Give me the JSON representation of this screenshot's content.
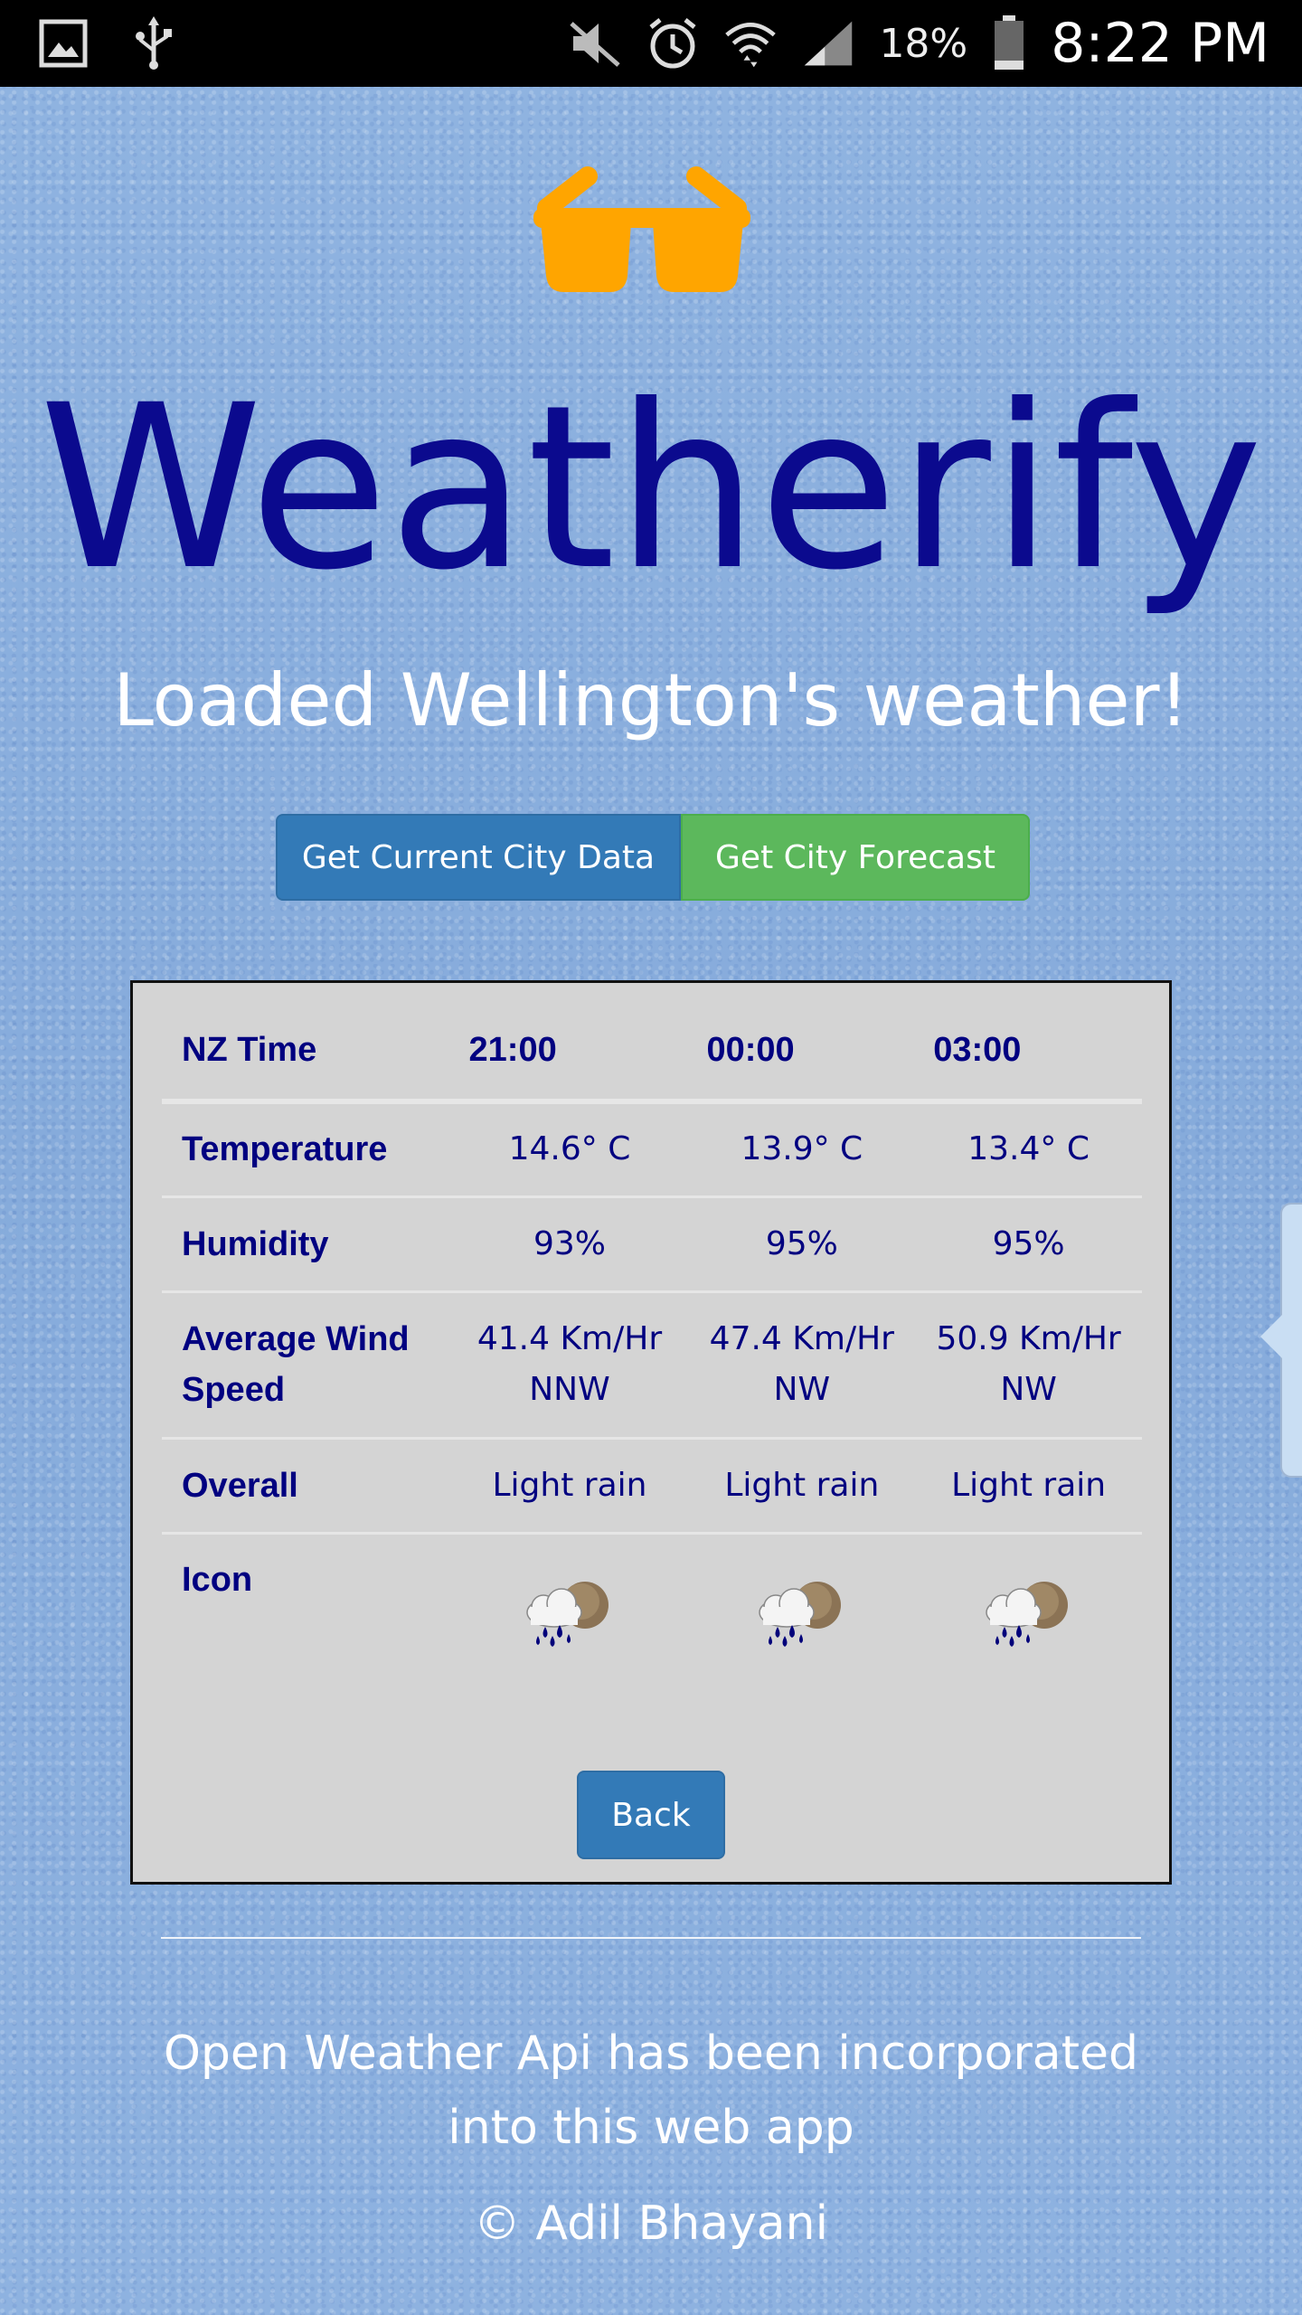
{
  "status_bar": {
    "icons": [
      "gallery-icon",
      "usb-icon",
      "mute-icon",
      "alarm-icon",
      "wifi-icon",
      "signal-icon",
      "battery-icon"
    ],
    "battery_percent": "18%",
    "time": "8:22 PM"
  },
  "app": {
    "logo_icon": "sunglasses-icon",
    "title": "Weatherify",
    "status_message": "Loaded Wellington's weather!"
  },
  "actions": {
    "current_label": "Get Current City Data",
    "forecast_label": "Get City Forecast",
    "back_label": "Back"
  },
  "forecast": {
    "time_header": "NZ Time",
    "times": [
      "21:00",
      "00:00",
      "03:00"
    ],
    "rows": {
      "temperature": {
        "label": "Temperature",
        "values": [
          "14.6° C",
          "13.9° C",
          "13.4° C"
        ]
      },
      "humidity": {
        "label": "Humidity",
        "values": [
          "93%",
          "95%",
          "95%"
        ]
      },
      "wind": {
        "label": "Average Wind Speed",
        "values": [
          "41.4 Km/Hr NNW",
          "47.4 Km/Hr NW",
          "50.9 Km/Hr NW"
        ]
      },
      "overall": {
        "label": "Overall",
        "values": [
          "Light rain",
          "Light rain",
          "Light rain"
        ]
      },
      "icon": {
        "label": "Icon",
        "values": [
          "light-rain-icon",
          "light-rain-icon",
          "light-rain-icon"
        ]
      }
    }
  },
  "footer": {
    "note": "Open Weather Api has been incorporated into this web app",
    "copyright": "© Adil Bhayani"
  },
  "colors": {
    "title": "#0b0a8e",
    "table_text": "#000080",
    "primary_button": "#337ab7",
    "success_button": "#5cb85c",
    "logo": "#ffa500",
    "panel_bg": "#d4d4d4"
  }
}
